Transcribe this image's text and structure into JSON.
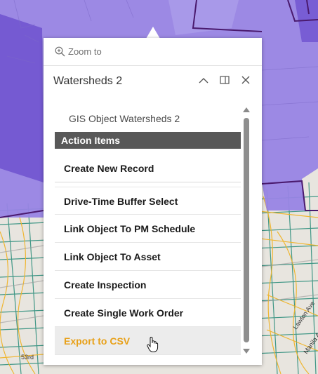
{
  "map": {
    "street_labels": [
      "Lawton Ave",
      "Manila Ave",
      "53rd"
    ]
  },
  "popup": {
    "zoom_label": "Zoom to",
    "title": "Watersheds 2",
    "subtitle": "GIS Object Watersheds 2",
    "section_header": "Action Items",
    "actions": [
      "Create New Record",
      "Drive-Time Buffer Select",
      "Link Object To PM Schedule",
      "Link Object To Asset",
      "Create Inspection",
      "Create Single Work Order",
      "Export to CSV"
    ],
    "highlight_color": "#e8a11a"
  },
  "colors": {
    "watershed_fill": "#9884e4",
    "watershed_dark": "#6f52cf",
    "boundary": "#4a1a6e",
    "street_major": "#f0b429",
    "street_green": "#2f8f7d"
  }
}
